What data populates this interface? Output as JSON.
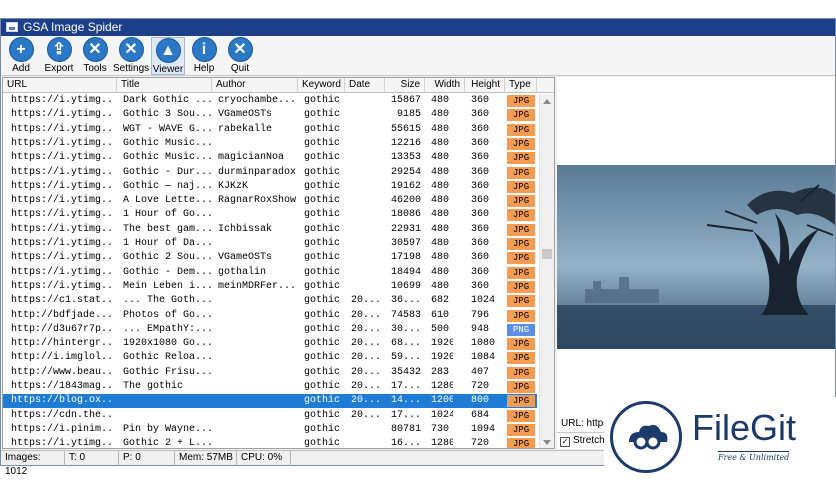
{
  "window": {
    "title": "GSA Image Spider"
  },
  "toolbar": [
    {
      "label": "Add",
      "icon": "add-icon",
      "glyph": "+"
    },
    {
      "label": "Export",
      "icon": "export-icon",
      "glyph": "⇪"
    },
    {
      "label": "Tools",
      "icon": "tools-icon",
      "glyph": "✕"
    },
    {
      "label": "Settings",
      "icon": "settings-icon",
      "glyph": "✕"
    },
    {
      "label": "Viewer",
      "icon": "viewer-icon",
      "glyph": "▲"
    },
    {
      "label": "Help",
      "icon": "help-icon",
      "glyph": "i"
    },
    {
      "label": "Quit",
      "icon": "quit-icon",
      "glyph": "✕"
    }
  ],
  "columns": [
    "URL",
    "Title",
    "Author",
    "Keyword",
    "Date",
    "Size",
    "Width",
    "Height",
    "Type"
  ],
  "rows": [
    [
      "https://i.ytimg...",
      "Dark Gothic ...",
      "cryochambe...",
      "gothic",
      "",
      "15867",
      "480",
      "360",
      "JPG"
    ],
    [
      "https://i.ytimg...",
      "Gothic 3 Sou...",
      "VGameOSTs",
      "gothic",
      "",
      "9185",
      "480",
      "360",
      "JPG"
    ],
    [
      "https://i.ytimg...",
      "WGT - WAVE G...",
      "rabekalle",
      "gothic",
      "",
      "55615",
      "480",
      "360",
      "JPG"
    ],
    [
      "https://i.ytimg...",
      "Gothic Music...",
      "",
      "gothic",
      "",
      "12216",
      "480",
      "360",
      "JPG"
    ],
    [
      "https://i.ytimg...",
      "Gothic Music...",
      "magicianNoa",
      "gothic",
      "",
      "13353",
      "480",
      "360",
      "JPG"
    ],
    [
      "https://i.ytimg...",
      "Gothic - Dur...",
      "durminparadox",
      "gothic",
      "",
      "29254",
      "480",
      "360",
      "JPG"
    ],
    [
      "https://i.ytimg...",
      "Gothic — naj...",
      "KJKzK",
      "gothic",
      "",
      "19162",
      "480",
      "360",
      "JPG"
    ],
    [
      "https://i.ytimg...",
      "A Love Lette...",
      "RagnarRoxShow",
      "gothic",
      "",
      "46200",
      "480",
      "360",
      "JPG"
    ],
    [
      "https://i.ytimg...",
      "1 Hour of Go...",
      "",
      "gothic",
      "",
      "18086",
      "480",
      "360",
      "JPG"
    ],
    [
      "https://i.ytimg...",
      "The best gam...",
      "Ichbissak",
      "gothic",
      "",
      "22931",
      "480",
      "360",
      "JPG"
    ],
    [
      "https://i.ytimg...",
      "1 Hour of Da...",
      "",
      "gothic",
      "",
      "30597",
      "480",
      "360",
      "JPG"
    ],
    [
      "https://i.ytimg...",
      "Gothic 2 Sou...",
      "VGameOSTs",
      "gothic",
      "",
      "17198",
      "480",
      "360",
      "JPG"
    ],
    [
      "https://i.ytimg...",
      "Gothic - Dem...",
      "gothalin",
      "gothic",
      "",
      "18494",
      "480",
      "360",
      "JPG"
    ],
    [
      "https://i.ytimg...",
      "Mein Leben i...",
      "meinMDRFer...",
      "gothic",
      "",
      "10699",
      "480",
      "360",
      "JPG"
    ],
    [
      "https://c1.stat...",
      "... The Goth...",
      "",
      "gothic",
      "20...",
      "36...",
      "682",
      "1024",
      "JPG"
    ],
    [
      "http://bdfjade...",
      "Photos of Go...",
      "",
      "gothic",
      "20...",
      "74583",
      "610",
      "796",
      "JPG"
    ],
    [
      "http://d3u67r7p...",
      "... EMpathY:...",
      "",
      "gothic",
      "20...",
      "30...",
      "500",
      "948",
      "PNG"
    ],
    [
      "http://hintergr...",
      "1920x1080 Go...",
      "",
      "gothic",
      "20...",
      "68...",
      "1920",
      "1080",
      "JPG"
    ],
    [
      "http://i.imglol...",
      "Gothic Reloa...",
      "",
      "gothic",
      "20...",
      "59...",
      "1920",
      "1084",
      "JPG"
    ],
    [
      "http://www.beau...",
      "Gothic Frisu...",
      "",
      "gothic",
      "20...",
      "35432",
      "283",
      "407",
      "JPG"
    ],
    [
      "https://1843mag...",
      "The gothic",
      "",
      "gothic",
      "20...",
      "17...",
      "1280",
      "720",
      "JPG"
    ],
    [
      "https://blog.ox...",
      "",
      "",
      "gothic",
      "20...",
      "14...",
      "1200",
      "800",
      "JPG"
    ],
    [
      "https://cdn.the...",
      "",
      "",
      "gothic",
      "20...",
      "17...",
      "1024",
      "684",
      "JPG"
    ],
    [
      "https://i.pinim...",
      "Pin by Wayne...",
      "",
      "gothic",
      "",
      "80781",
      "730",
      "1094",
      "JPG"
    ],
    [
      "https://i.ytimg...",
      "Gothic 2 + L...",
      "",
      "gothic",
      "",
      "16...",
      "1280",
      "720",
      "JPG"
    ]
  ],
  "selected_row": 21,
  "preview": {
    "url_label": "URL: https:",
    "stretch_label": "Stretch",
    "stretch_checked": true
  },
  "status": {
    "images": "Images: 1012",
    "threads": "T: 0",
    "pending": "P: 0",
    "memory": "Mem: 57MB",
    "cpu": "CPU: 0%"
  },
  "watermark": {
    "name": "FileGit",
    "tagline": "Free & Unlimited"
  },
  "colors": {
    "title_bar": "#1b3f8a",
    "selection": "#1e7bd6",
    "jpg_badge": "#f59c52",
    "png_badge": "#5b8fe6",
    "toolbar_icon": "#2a78c6"
  }
}
